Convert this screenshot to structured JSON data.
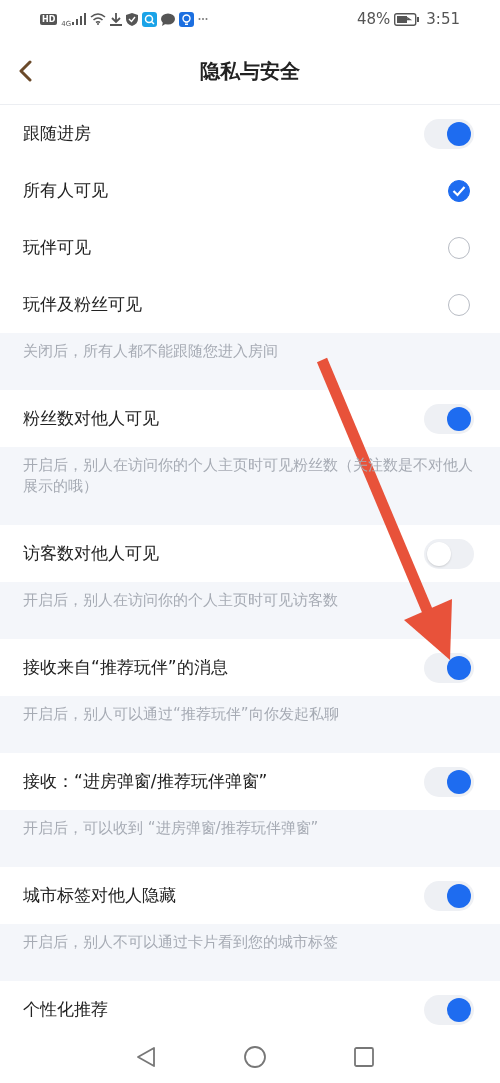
{
  "status_bar": {
    "network_badge": "HD",
    "network_type": "4G",
    "battery_percent": "48%",
    "time": "3:51"
  },
  "header": {
    "title": "隐私与安全"
  },
  "sections": [
    {
      "rows": [
        {
          "kind": "toggle",
          "label": "跟随进房",
          "on": true
        },
        {
          "kind": "radio",
          "label": "所有人可见",
          "selected": true
        },
        {
          "kind": "radio",
          "label": "玩伴可见",
          "selected": false
        },
        {
          "kind": "radio",
          "label": "玩伴及粉丝可见",
          "selected": false
        }
      ],
      "note": "关闭后，所有人都不能跟随您进入房间"
    },
    {
      "rows": [
        {
          "kind": "toggle",
          "label": "粉丝数对他人可见",
          "on": true
        }
      ],
      "note": "开启后，别人在访问你的个人主页时可见粉丝数（关注数是不对他人展示的哦）"
    },
    {
      "rows": [
        {
          "kind": "toggle",
          "label": "访客数对他人可见",
          "on": false
        }
      ],
      "note": "开启后，别人在访问你的个人主页时可见访客数"
    },
    {
      "rows": [
        {
          "kind": "toggle",
          "label": "接收来自“推荐玩伴”的消息",
          "on": true
        }
      ],
      "note": "开启后，别人可以通过“推荐玩伴”向你发起私聊"
    },
    {
      "rows": [
        {
          "kind": "toggle",
          "label": "接收：“进房弹窗/推荐玩伴弹窗”",
          "on": true
        }
      ],
      "note": "开启后，可以收到 “进房弹窗/推荐玩伴弹窗”"
    },
    {
      "rows": [
        {
          "kind": "toggle",
          "label": "城市标签对他人隐藏",
          "on": true
        }
      ],
      "note": "开启后，别人不可以通过卡片看到您的城市标签"
    },
    {
      "rows": [
        {
          "kind": "toggle",
          "label": "个性化推荐",
          "on": true
        }
      ]
    }
  ]
}
